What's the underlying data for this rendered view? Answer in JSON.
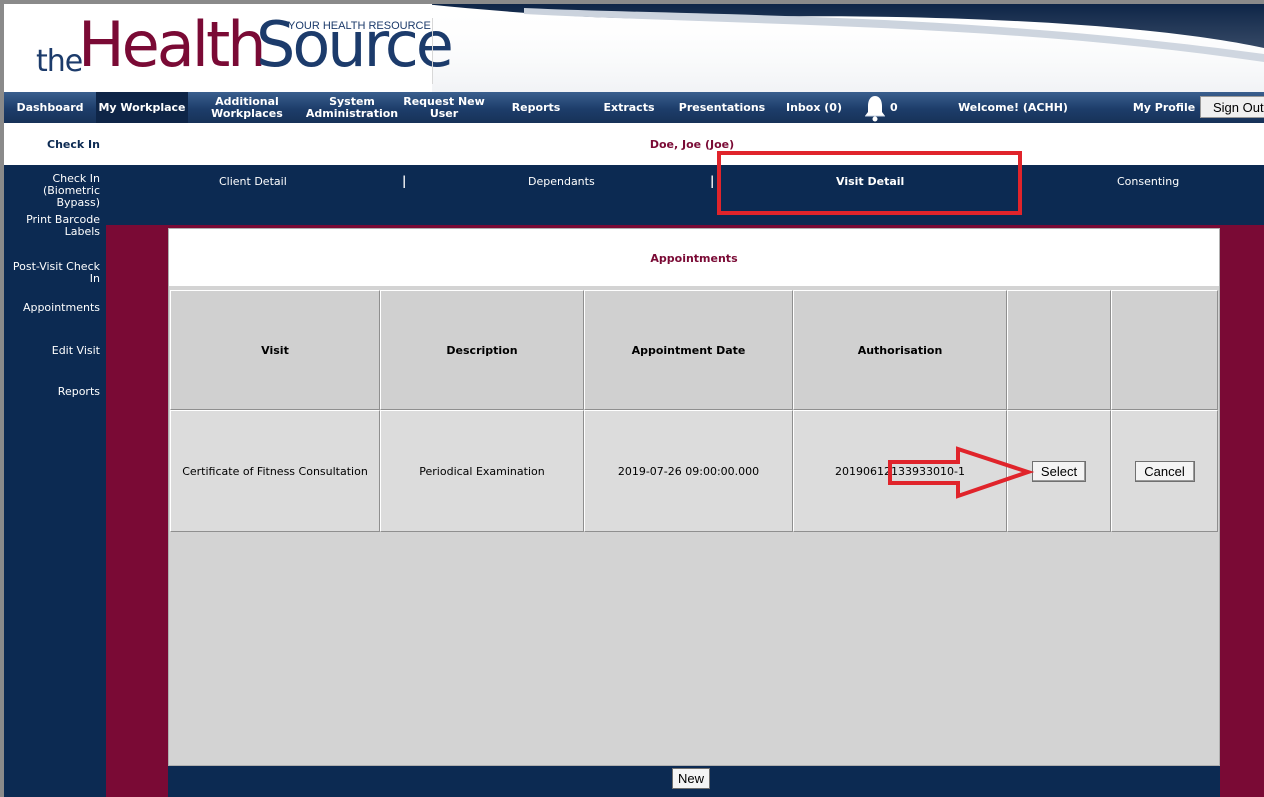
{
  "brand": {
    "logo_the": "the",
    "logo_health": "Health",
    "logo_source": "Source",
    "tagline": "YOUR HEALTH RESOURCE",
    "primary_color": "#1c3b6b",
    "accent_color": "#7a0a35"
  },
  "topnav": {
    "items": [
      {
        "label": "Dashboard"
      },
      {
        "label": "My Workplace",
        "active": true
      },
      {
        "label": "Additional Workplaces"
      },
      {
        "label": "System Administration"
      },
      {
        "label": "Request New User"
      },
      {
        "label": "Reports"
      },
      {
        "label": "Extracts"
      },
      {
        "label": "Presentations"
      },
      {
        "label": "Inbox (0)"
      }
    ],
    "notification_count": "0",
    "notification_icon": "bell-icon",
    "welcome": "Welcome! (ACHH)",
    "my_profile": "My Profile",
    "sign_out": "Sign Out"
  },
  "sidebar": {
    "checkin": "Check In",
    "items": [
      {
        "label": "Check In (Biometric Bypass)"
      },
      {
        "label": "Print Barcode Labels"
      },
      {
        "label": "Post-Visit Check In"
      },
      {
        "label": "Appointments"
      },
      {
        "label": "Edit Visit"
      },
      {
        "label": "Reports"
      }
    ]
  },
  "patient": {
    "name": "Doe, Joe (Joe)"
  },
  "tabs": {
    "items": [
      {
        "label": "Client Detail"
      },
      {
        "label": "Dependants"
      },
      {
        "label": "Visit Detail",
        "active": true
      },
      {
        "label": "Consenting"
      }
    ],
    "separator": "|"
  },
  "appointments": {
    "heading": "Appointments",
    "columns": [
      "Visit",
      "Description",
      "Appointment Date",
      "Authorisation",
      "",
      ""
    ],
    "rows": [
      {
        "visit": "Certificate of Fitness Consultation",
        "description": "Periodical Examination",
        "date": "2019-07-26 09:00:00.000",
        "authorisation": "20190612133933010-1",
        "select_label": "Select",
        "cancel_label": "Cancel"
      }
    ],
    "new_label": "New"
  },
  "annotation": {
    "highlight_color": "#e0242b"
  }
}
